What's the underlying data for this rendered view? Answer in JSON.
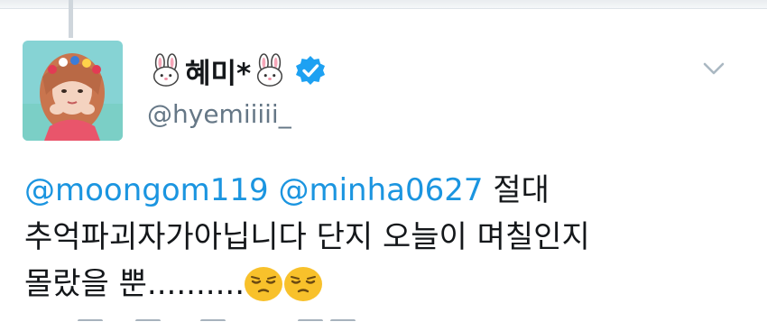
{
  "tweet": {
    "author": {
      "display_name": "혜미*",
      "handle": "@hyemiiiii_",
      "verified": true,
      "avatar_icon": "avatar-photo",
      "name_emoji": "rabbit-face"
    },
    "menu_icon": "chevron-down-icon",
    "mentions": [
      "@moongom119",
      "@minha0627"
    ],
    "text_line1_rest": " 절대",
    "text_line2": "추억파괴자가아닙니다 단지 오늘이 며칠인지",
    "text_line3": "몰랐을 뿐..........",
    "trailing_emoji": "pensive-face",
    "colors": {
      "mention": "#1b95e0",
      "verified": "#1da1f2",
      "handle": "#657786",
      "emoji": "#f8c12b"
    }
  }
}
